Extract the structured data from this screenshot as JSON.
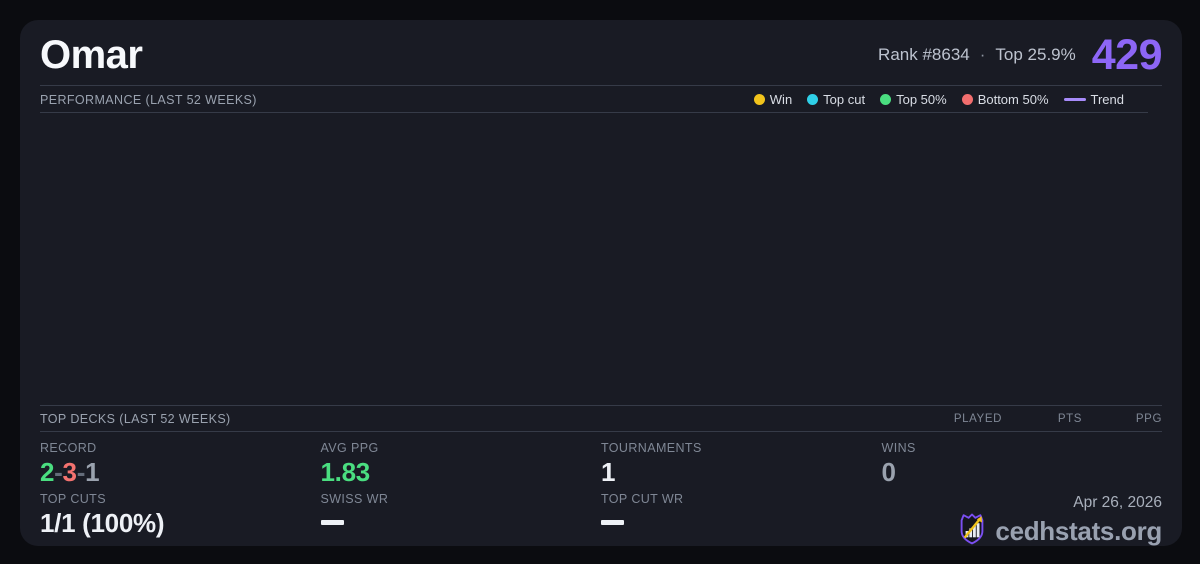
{
  "header": {
    "title": "Omar",
    "rank_label": "Rank #8634",
    "separator": "·",
    "percentile_label": "Top 25.9%",
    "elo_score": "429",
    "score_color": "#8d66f6"
  },
  "performance": {
    "section_label": "PERFORMANCE (LAST 52 WEEKS)",
    "legend": [
      {
        "label": "Win",
        "color": "#f2c41c",
        "marker": "dot"
      },
      {
        "label": "Top cut",
        "color": "#2fd0e8",
        "marker": "dot"
      },
      {
        "label": "Top 50%",
        "color": "#4ade80",
        "marker": "dot"
      },
      {
        "label": "Bottom 50%",
        "color": "#f26e6e",
        "marker": "dot"
      },
      {
        "label": "Trend",
        "color": "#a78bfa",
        "marker": "line"
      }
    ],
    "chart_points": []
  },
  "top_decks": {
    "section_label": "TOP DECKS (LAST 52 WEEKS)",
    "columns": [
      "PLAYED",
      "PTS",
      "PPG"
    ],
    "rows": []
  },
  "stats": {
    "record": {
      "label": "RECORD",
      "wins": "2",
      "losses": "3",
      "draws": "1",
      "separator": "-",
      "wins_color": "#4ade80",
      "losses_color": "#f4726f",
      "draws_color": "#9aa2ae"
    },
    "avg_ppg": {
      "label": "AVG PPG",
      "value": "1.83",
      "color": "#4ade80"
    },
    "tournaments": {
      "label": "TOURNAMENTS",
      "value": "1"
    },
    "wins": {
      "label": "WINS",
      "value": "0",
      "color": "#9aa2ae"
    },
    "top_cuts": {
      "label": "TOP CUTS",
      "value": "1/1 (100%)"
    },
    "swiss_wr": {
      "label": "SWISS WR",
      "value": "—"
    },
    "top_cut_wr": {
      "label": "TOP CUT WR",
      "value": "—"
    }
  },
  "footer": {
    "date": "Apr 26, 2026",
    "brand": "cedhstats.org"
  }
}
